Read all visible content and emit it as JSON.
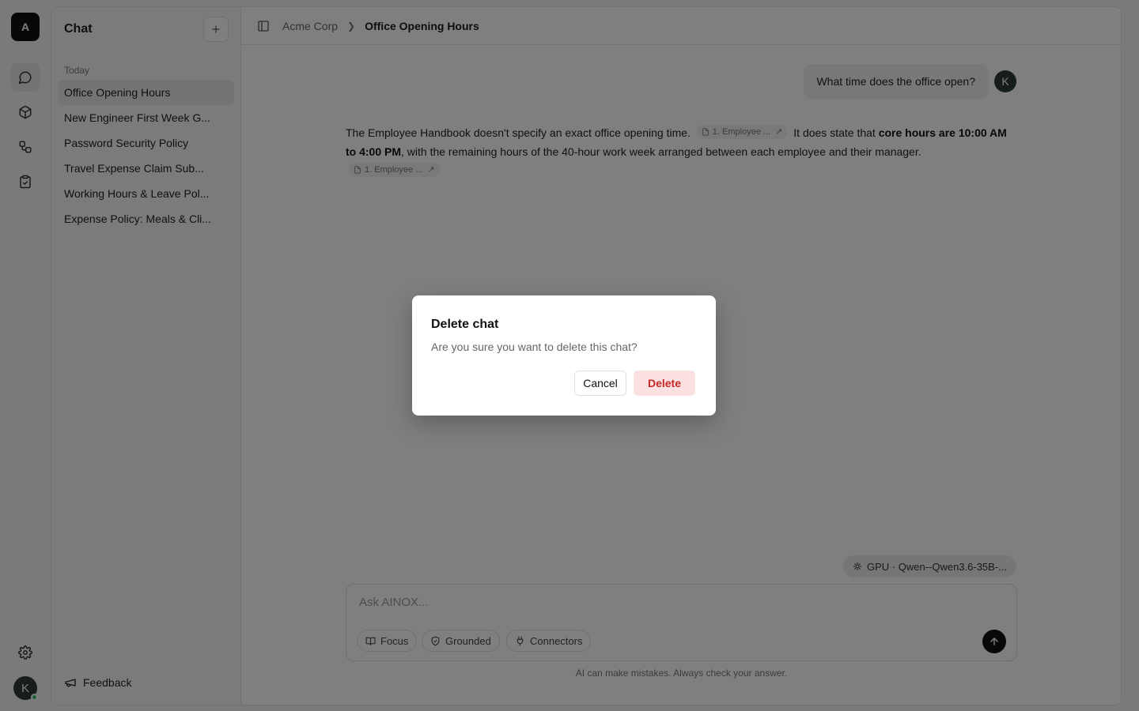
{
  "workspace": {
    "initial": "A"
  },
  "rail": {
    "items": [
      {
        "name": "chat-icon",
        "active": true
      },
      {
        "name": "cube-icon",
        "active": false
      },
      {
        "name": "workflow-icon",
        "active": false
      },
      {
        "name": "clipboard-check-icon",
        "active": false
      }
    ],
    "user_initial": "K"
  },
  "sidebar": {
    "title": "Chat",
    "group_label": "Today",
    "chats": [
      "Office Opening Hours",
      "New Engineer First Week G...",
      "Password Security Policy",
      "Travel Expense Claim Sub...",
      "Working Hours & Leave Pol...",
      "Expense Policy: Meals & Cli..."
    ],
    "active_index": 0,
    "feedback_label": "Feedback"
  },
  "header": {
    "breadcrumb_root": "Acme Corp",
    "breadcrumb_current": "Office Opening Hours"
  },
  "conversation": {
    "user_message": "What time does the office open?",
    "user_initial": "K",
    "answer": {
      "part1": "The Employee Handbook doesn't specify an exact office opening time.",
      "cite1": "1. Employee ...",
      "part2": "It does state that ",
      "bold": "core hours are 10:00 AM to 4:00 PM",
      "part3": ", with the remaining hours of the 40-hour work week arranged between each employee and their manager.",
      "cite2": "1. Employee ..."
    }
  },
  "composer": {
    "model_label": "GPU · Qwen--Qwen3.6-35B-...",
    "placeholder": "Ask AINOX...",
    "tools": [
      "Focus",
      "Grounded",
      "Connectors"
    ],
    "disclaimer": "AI can make mistakes. Always check your answer."
  },
  "dialog": {
    "title": "Delete chat",
    "message": "Are you sure you want to delete this chat?",
    "cancel_label": "Cancel",
    "delete_label": "Delete",
    "delete_color": "#c62828"
  }
}
